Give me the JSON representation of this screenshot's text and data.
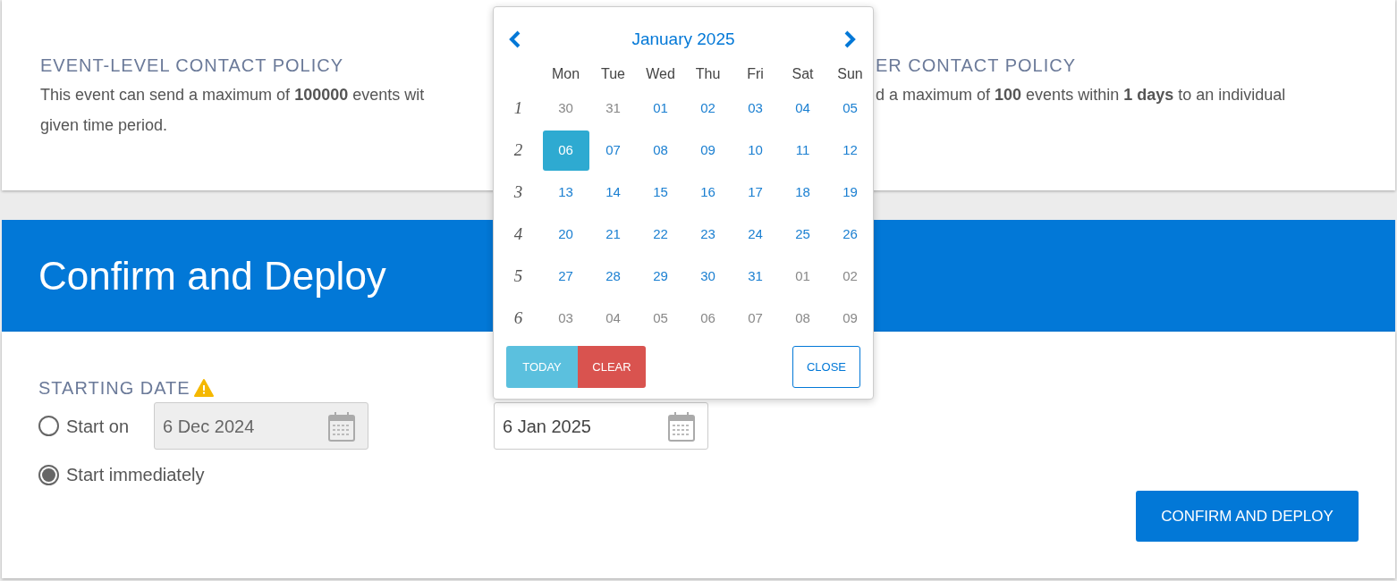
{
  "policies": [
    {
      "heading": "EVENT-LEVEL CONTACT POLICY",
      "lines": [
        "This event can send a maximum of **100000** events wit",
        "given time period."
      ]
    },
    {
      "heading": "ER CONTACT POLICY",
      "lines": [
        "d a maximum of **100** events within **1 days** to an individual"
      ]
    }
  ],
  "banner": {
    "title": "Confirm and Deploy"
  },
  "starting_date": {
    "label": "STARTING DATE",
    "warning": true,
    "options": [
      {
        "label": "Start on",
        "selected": false
      },
      {
        "label": "Start immediately",
        "selected": true
      }
    ],
    "fields": [
      {
        "value": "6 Dec 2024",
        "disabled": true
      },
      {
        "value": "6 Jan 2025",
        "disabled": false
      }
    ]
  },
  "confirm_button": "CONFIRM AND DEPLOY",
  "calendar": {
    "title": "January 2025",
    "weekdays": [
      "Mon",
      "Tue",
      "Wed",
      "Thu",
      "Fri",
      "Sat",
      "Sun"
    ],
    "weeks": [
      {
        "number": "1",
        "days": [
          {
            "label": "30",
            "other_month": true,
            "selected": false
          },
          {
            "label": "31",
            "other_month": true,
            "selected": false
          },
          {
            "label": "01",
            "other_month": false,
            "selected": false
          },
          {
            "label": "02",
            "other_month": false,
            "selected": false
          },
          {
            "label": "03",
            "other_month": false,
            "selected": false
          },
          {
            "label": "04",
            "other_month": false,
            "selected": false
          },
          {
            "label": "05",
            "other_month": false,
            "selected": false
          }
        ]
      },
      {
        "number": "2",
        "days": [
          {
            "label": "06",
            "other_month": false,
            "selected": true
          },
          {
            "label": "07",
            "other_month": false,
            "selected": false
          },
          {
            "label": "08",
            "other_month": false,
            "selected": false
          },
          {
            "label": "09",
            "other_month": false,
            "selected": false
          },
          {
            "label": "10",
            "other_month": false,
            "selected": false
          },
          {
            "label": "11",
            "other_month": false,
            "selected": false
          },
          {
            "label": "12",
            "other_month": false,
            "selected": false
          }
        ]
      },
      {
        "number": "3",
        "days": [
          {
            "label": "13",
            "other_month": false,
            "selected": false
          },
          {
            "label": "14",
            "other_month": false,
            "selected": false
          },
          {
            "label": "15",
            "other_month": false,
            "selected": false
          },
          {
            "label": "16",
            "other_month": false,
            "selected": false
          },
          {
            "label": "17",
            "other_month": false,
            "selected": false
          },
          {
            "label": "18",
            "other_month": false,
            "selected": false
          },
          {
            "label": "19",
            "other_month": false,
            "selected": false
          }
        ]
      },
      {
        "number": "4",
        "days": [
          {
            "label": "20",
            "other_month": false,
            "selected": false
          },
          {
            "label": "21",
            "other_month": false,
            "selected": false
          },
          {
            "label": "22",
            "other_month": false,
            "selected": false
          },
          {
            "label": "23",
            "other_month": false,
            "selected": false
          },
          {
            "label": "24",
            "other_month": false,
            "selected": false
          },
          {
            "label": "25",
            "other_month": false,
            "selected": false
          },
          {
            "label": "26",
            "other_month": false,
            "selected": false
          }
        ]
      },
      {
        "number": "5",
        "days": [
          {
            "label": "27",
            "other_month": false,
            "selected": false
          },
          {
            "label": "28",
            "other_month": false,
            "selected": false
          },
          {
            "label": "29",
            "other_month": false,
            "selected": false
          },
          {
            "label": "30",
            "other_month": false,
            "selected": false
          },
          {
            "label": "31",
            "other_month": false,
            "selected": false
          },
          {
            "label": "01",
            "other_month": true,
            "selected": false
          },
          {
            "label": "02",
            "other_month": true,
            "selected": false
          }
        ]
      },
      {
        "number": "6",
        "days": [
          {
            "label": "03",
            "other_month": true,
            "selected": false
          },
          {
            "label": "04",
            "other_month": true,
            "selected": false
          },
          {
            "label": "05",
            "other_month": true,
            "selected": false
          },
          {
            "label": "06",
            "other_month": true,
            "selected": false
          },
          {
            "label": "07",
            "other_month": true,
            "selected": false
          },
          {
            "label": "08",
            "other_month": true,
            "selected": false
          },
          {
            "label": "09",
            "other_month": true,
            "selected": false
          }
        ]
      }
    ],
    "buttons": [
      {
        "kind": "today",
        "label": "TODAY"
      },
      {
        "kind": "clear",
        "label": "CLEAR"
      },
      {
        "kind": "close",
        "label": "CLOSE"
      }
    ]
  }
}
